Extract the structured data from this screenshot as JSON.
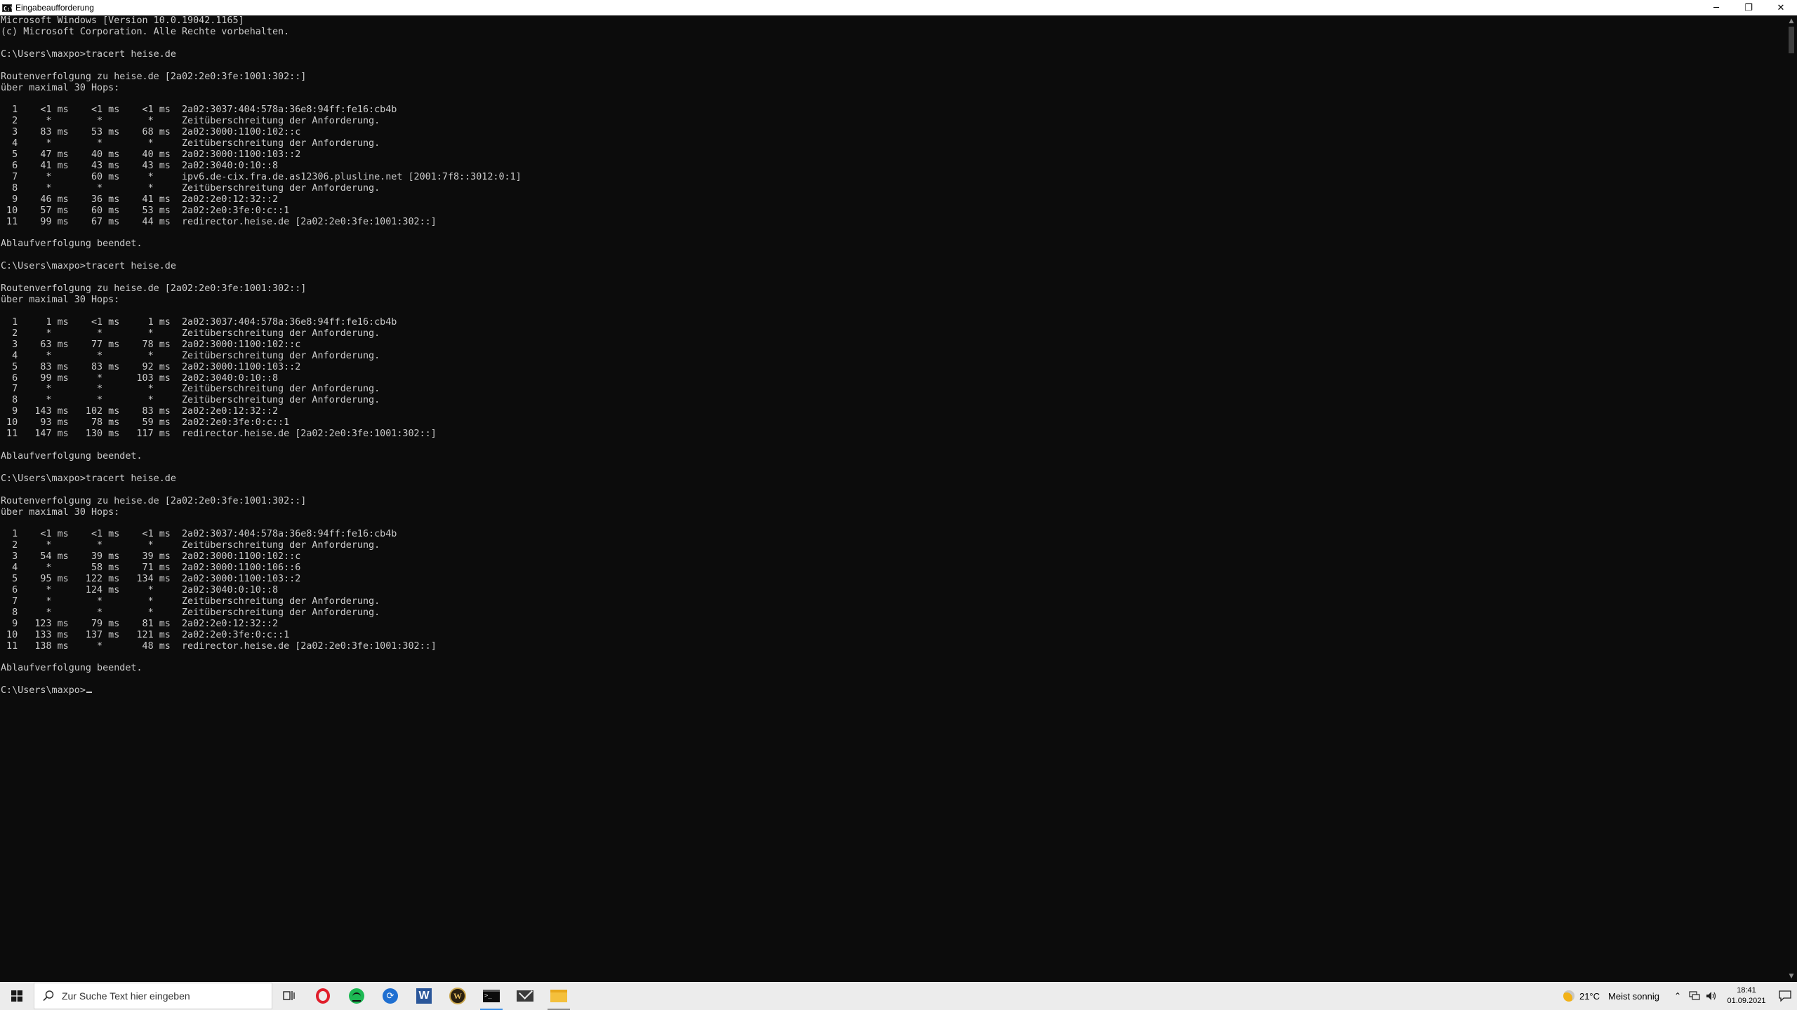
{
  "window": {
    "title": "Eingabeaufforderung",
    "app_icon_text": "C:\\",
    "controls": {
      "minimize": "─",
      "restore": "❐",
      "close": "✕"
    }
  },
  "console_lines": [
    "Microsoft Windows [Version 10.0.19042.1165]",
    "(c) Microsoft Corporation. Alle Rechte vorbehalten.",
    "",
    "C:\\Users\\maxpo>tracert heise.de",
    "",
    "Routenverfolgung zu heise.de [2a02:2e0:3fe:1001:302::]",
    "über maximal 30 Hops:",
    "",
    "  1    <1 ms    <1 ms    <1 ms  2a02:3037:404:578a:36e8:94ff:fe16:cb4b",
    "  2     *        *        *     Zeitüberschreitung der Anforderung.",
    "  3    83 ms    53 ms    68 ms  2a02:3000:1100:102::c",
    "  4     *        *        *     Zeitüberschreitung der Anforderung.",
    "  5    47 ms    40 ms    40 ms  2a02:3000:1100:103::2",
    "  6    41 ms    43 ms    43 ms  2a02:3040:0:10::8",
    "  7     *       60 ms     *     ipv6.de-cix.fra.de.as12306.plusline.net [2001:7f8::3012:0:1]",
    "  8     *        *        *     Zeitüberschreitung der Anforderung.",
    "  9    46 ms    36 ms    41 ms  2a02:2e0:12:32::2",
    " 10    57 ms    60 ms    53 ms  2a02:2e0:3fe:0:c::1",
    " 11    99 ms    67 ms    44 ms  redirector.heise.de [2a02:2e0:3fe:1001:302::]",
    "",
    "Ablaufverfolgung beendet.",
    "",
    "C:\\Users\\maxpo>tracert heise.de",
    "",
    "Routenverfolgung zu heise.de [2a02:2e0:3fe:1001:302::]",
    "über maximal 30 Hops:",
    "",
    "  1     1 ms    <1 ms     1 ms  2a02:3037:404:578a:36e8:94ff:fe16:cb4b",
    "  2     *        *        *     Zeitüberschreitung der Anforderung.",
    "  3    63 ms    77 ms    78 ms  2a02:3000:1100:102::c",
    "  4     *        *        *     Zeitüberschreitung der Anforderung.",
    "  5    83 ms    83 ms    92 ms  2a02:3000:1100:103::2",
    "  6    99 ms     *      103 ms  2a02:3040:0:10::8",
    "  7     *        *        *     Zeitüberschreitung der Anforderung.",
    "  8     *        *        *     Zeitüberschreitung der Anforderung.",
    "  9   143 ms   102 ms    83 ms  2a02:2e0:12:32::2",
    " 10    93 ms    78 ms    59 ms  2a02:2e0:3fe:0:c::1",
    " 11   147 ms   130 ms   117 ms  redirector.heise.de [2a02:2e0:3fe:1001:302::]",
    "",
    "Ablaufverfolgung beendet.",
    "",
    "C:\\Users\\maxpo>tracert heise.de",
    "",
    "Routenverfolgung zu heise.de [2a02:2e0:3fe:1001:302::]",
    "über maximal 30 Hops:",
    "",
    "  1    <1 ms    <1 ms    <1 ms  2a02:3037:404:578a:36e8:94ff:fe16:cb4b",
    "  2     *        *        *     Zeitüberschreitung der Anforderung.",
    "  3    54 ms    39 ms    39 ms  2a02:3000:1100:102::c",
    "  4     *       58 ms    71 ms  2a02:3000:1100:106::6",
    "  5    95 ms   122 ms   134 ms  2a02:3000:1100:103::2",
    "  6     *      124 ms     *     2a02:3040:0:10::8",
    "  7     *        *        *     Zeitüberschreitung der Anforderung.",
    "  8     *        *        *     Zeitüberschreitung der Anforderung.",
    "  9   123 ms    79 ms    81 ms  2a02:2e0:12:32::2",
    " 10   133 ms   137 ms   121 ms  2a02:2e0:3fe:0:c::1",
    " 11   138 ms     *       48 ms  redirector.heise.de [2a02:2e0:3fe:1001:302::]",
    "",
    "Ablaufverfolgung beendet.",
    ""
  ],
  "prompt": "C:\\Users\\maxpo>",
  "taskbar": {
    "search_placeholder": "Zur Suche Text hier eingeben",
    "apps": [
      {
        "name": "task-view",
        "icon": "task-view-icon"
      },
      {
        "name": "opera",
        "icon": "opera-icon"
      },
      {
        "name": "spotify",
        "icon": "spotify-icon"
      },
      {
        "name": "sync",
        "icon": "sync-icon"
      },
      {
        "name": "word",
        "icon": "word-icon",
        "letter": "W"
      },
      {
        "name": "wow",
        "icon": "wow-icon",
        "letter": "W"
      },
      {
        "name": "command-prompt",
        "icon": "cmd-icon",
        "active": true
      },
      {
        "name": "mail",
        "icon": "mail-icon"
      },
      {
        "name": "file-explorer",
        "icon": "folder-icon"
      }
    ],
    "weather_temp": "21°C",
    "weather_desc": "Meist sonnig",
    "time": "18:41",
    "date": "01.09.2021"
  },
  "colors": {
    "console_bg": "#0c0c0c",
    "console_fg": "#cccccc",
    "taskbar_bg": "#ececec",
    "accent": "#3a8ee6"
  }
}
